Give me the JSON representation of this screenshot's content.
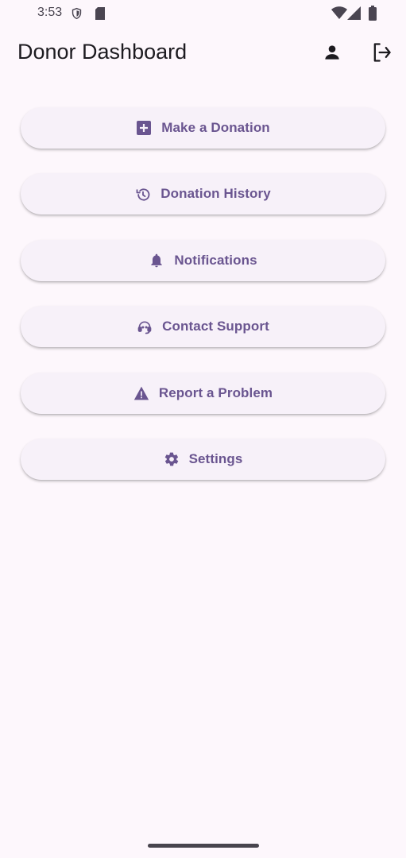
{
  "status_bar": {
    "time": "3:53",
    "icons": [
      "shield-icon",
      "sd-card-icon",
      "wifi-icon",
      "signal-icon",
      "battery-icon"
    ]
  },
  "app_bar": {
    "title": "Donor Dashboard",
    "actions": [
      "profile-icon",
      "logout-icon"
    ]
  },
  "menu": {
    "items": [
      {
        "label": "Make a Donation",
        "icon": "add-box-icon"
      },
      {
        "label": "Donation History",
        "icon": "history-icon"
      },
      {
        "label": "Notifications",
        "icon": "bell-icon"
      },
      {
        "label": "Contact Support",
        "icon": "support-agent-icon"
      },
      {
        "label": "Report a Problem",
        "icon": "warning-icon"
      },
      {
        "label": "Settings",
        "icon": "gear-icon"
      }
    ]
  },
  "colors": {
    "background": "#fdf7fc",
    "button_bg": "#f7f1f9",
    "accent": "#6a5590"
  }
}
